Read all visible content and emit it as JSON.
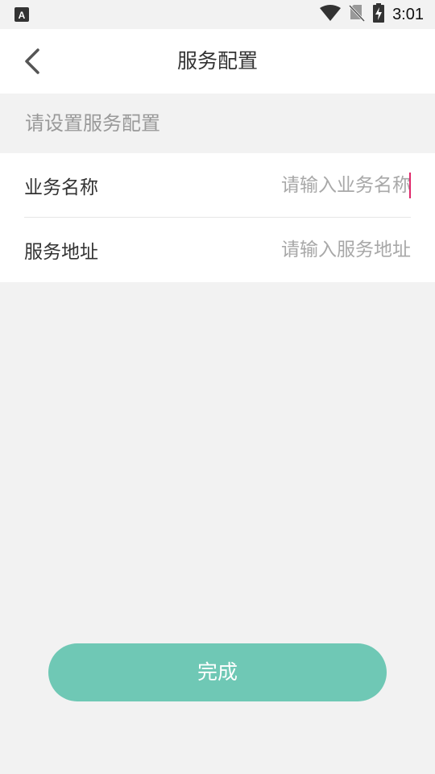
{
  "status_bar": {
    "time": "3:01",
    "icons": [
      "app-notification-icon",
      "wifi-icon",
      "no-sim-icon",
      "battery-charging-icon"
    ]
  },
  "header": {
    "title": "服务配置",
    "back_icon": "chevron-left-icon"
  },
  "section": {
    "hint": "请设置服务配置"
  },
  "form": {
    "fields": [
      {
        "label": "业务名称",
        "value": "",
        "placeholder": "请输入业务名称"
      },
      {
        "label": "服务地址",
        "value": "",
        "placeholder": "请输入服务地址"
      }
    ]
  },
  "footer": {
    "submit_label": "完成"
  },
  "colors": {
    "accent": "#6fc8b5",
    "caret": "#e0286b",
    "background": "#f2f2f2"
  }
}
